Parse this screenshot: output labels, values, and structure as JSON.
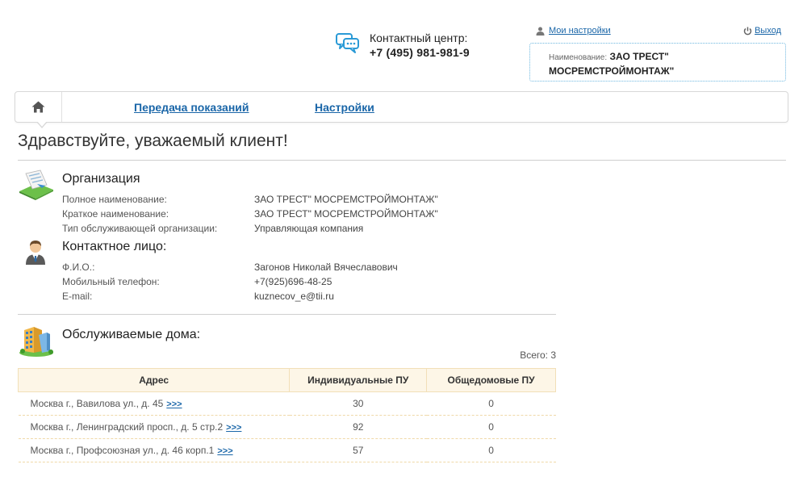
{
  "header": {
    "contact_label": "Контактный центр:",
    "contact_phone": "+7 (495) 981-981-9",
    "settings_link": "Мои настройки",
    "logout_link": "Выход",
    "org_name_label": "Наименование:",
    "org_name_line1": "ЗАО ТРЕСТ\"",
    "org_name_line2": "МОСРЕМСТРОЙМОНТАЖ\""
  },
  "nav": {
    "items": [
      {
        "label": "Передача показаний"
      },
      {
        "label": "Настройки"
      }
    ]
  },
  "greeting": "Здравствуйте, уважаемый клиент!",
  "organization": {
    "title": "Организация",
    "fields": [
      {
        "label": "Полное наименование:",
        "value": "ЗАО ТРЕСТ\" МОСРЕМСТРОЙМОНТАЖ\""
      },
      {
        "label": "Краткое наименование:",
        "value": "ЗАО ТРЕСТ\" МОСРЕМСТРОЙМОНТАЖ\""
      },
      {
        "label": "Тип обслуживающей организации:",
        "value": "Управляющая компания"
      }
    ]
  },
  "contact_person": {
    "title": "Контактное лицо:",
    "fields": [
      {
        "label": "Ф.И.О.:",
        "value": "Загонов Николай Вячеславович"
      },
      {
        "label": "Мобильный телефон:",
        "value": "+7(925)696-48-25"
      },
      {
        "label": "E-mail:",
        "value": "kuznecov_e@tii.ru"
      }
    ]
  },
  "houses": {
    "title": "Обслуживаемые дома:",
    "total": "Всего: 3",
    "columns": [
      "Адрес",
      "Индивидуальные ПУ",
      "Общедомовые ПУ"
    ],
    "link_text": ">>>",
    "rows": [
      {
        "address": "Москва г., Вавилова ул., д. 45",
        "individual": "30",
        "common": "0"
      },
      {
        "address": "Москва г., Ленинградский просп., д. 5 стр.2",
        "individual": "92",
        "common": "0"
      },
      {
        "address": "Москва г., Профсоюзная ул., д. 46 корп.1",
        "individual": "57",
        "common": "0"
      }
    ]
  },
  "colors": {
    "link": "#1a66a8",
    "table_header_bg": "#fdf6e7",
    "table_border": "#f2dfb8"
  },
  "icons": [
    "chat-bubbles-icon",
    "user-icon",
    "power-icon",
    "home-icon",
    "document-icon",
    "person-icon",
    "buildings-icon"
  ]
}
